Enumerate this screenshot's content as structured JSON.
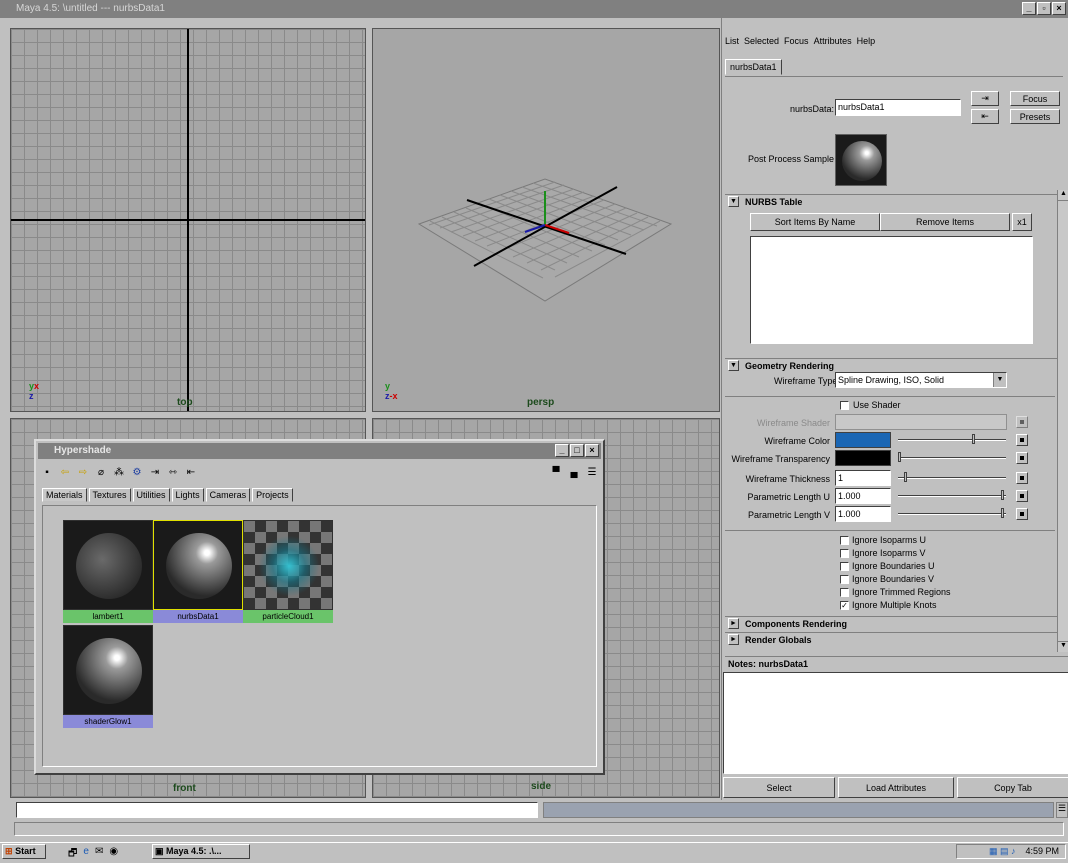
{
  "window": {
    "title": "Maya 4.5: \\untitled  ---  nurbsData1"
  },
  "viewports": {
    "top": "top",
    "persp": "persp",
    "front": "front",
    "side": "side"
  },
  "hypershade": {
    "title": "Hypershade",
    "tabs": [
      "Materials",
      "Textures",
      "Utilities",
      "Lights",
      "Cameras",
      "Projects"
    ],
    "swatches": [
      "lambert1",
      "nurbsData1",
      "particleCloud1",
      "shaderGlow1"
    ]
  },
  "attr_editor": {
    "menu": [
      "List",
      "Selected",
      "Focus",
      "Attributes",
      "Help"
    ],
    "tab": "nurbsData1",
    "node_label": "nurbsData:",
    "node_value": "nurbsData1",
    "focus_btn": "Focus",
    "presets_btn": "Presets",
    "sample_label": "Post Process Sample",
    "nurbs_table": {
      "header": "NURBS Table",
      "sort_btn": "Sort Items By Name",
      "remove_btn": "Remove Items",
      "x1_btn": "x1"
    },
    "geometry": {
      "header": "Geometry Rendering",
      "wire_type_label": "Wireframe Type",
      "wire_type_value": "Spline Drawing, ISO, Solid",
      "use_shader": "Use Shader",
      "wire_shader": "Wireframe Shader",
      "wire_color": "Wireframe Color",
      "wire_transp": "Wireframe Transparency",
      "wire_thick": "Wireframe Thickness",
      "wire_thick_val": "1",
      "plu": "Parametric Length U",
      "plu_val": "1.000",
      "plv": "Parametric Length V",
      "plv_val": "1.000",
      "colors": {
        "wire_color": "#1a66b4",
        "wire_transp": "#000000"
      },
      "checks": [
        {
          "label": "Ignore Isoparms U",
          "checked": false
        },
        {
          "label": "Ignore Isoparms V",
          "checked": false
        },
        {
          "label": "Ignore Boundaries U",
          "checked": false
        },
        {
          "label": "Ignore Boundaries V",
          "checked": false
        },
        {
          "label": "Ignore Trimmed Regions",
          "checked": false
        },
        {
          "label": "Ignore Multiple Knots",
          "checked": true
        }
      ],
      "check_mark": "✓"
    },
    "components": "Components Rendering",
    "render_globals": "Render Globals",
    "notes": "Notes: nurbsData1",
    "select_btn": "Select",
    "load_btn": "Load Attributes",
    "copy_btn": "Copy Tab"
  },
  "taskbar": {
    "start": "Start",
    "task": "Maya 4.5: .\\...",
    "time": "4:59 PM"
  }
}
